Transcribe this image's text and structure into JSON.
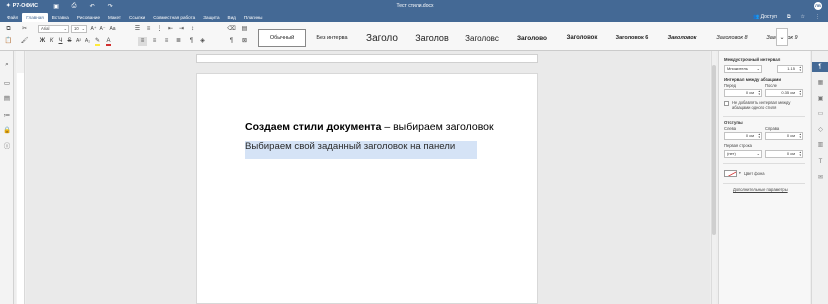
{
  "app": {
    "name": "Р7-ОФИС",
    "document_title": "Тест стили.docx",
    "user_initials": "ЛВ"
  },
  "menu": {
    "items": [
      "Файл",
      "Главная",
      "Вставка",
      "Рисование",
      "Макет",
      "Ссылки",
      "Совместная работа",
      "Защита",
      "Вид",
      "Плагины"
    ],
    "access_label": "Доступ"
  },
  "toolbar": {
    "font_name": "Arial",
    "font_size": "10",
    "styles": [
      "Обычный",
      "Без интерва",
      "Заголо",
      "Заголов",
      "Заголовс",
      "Заголово",
      "Заголовок",
      "Заголовок 6",
      "Заголовок",
      "Заголовок 8",
      "Заголовок 9"
    ]
  },
  "document": {
    "heading1_bold": "Создаем стили документа",
    "heading1_rest": " – выбираем заголовок",
    "heading2": "Выбираем свой заданный заголовок на панели"
  },
  "panel": {
    "line_spacing_title": "Междустрочный интервал",
    "line_spacing_mode": "Множитель",
    "line_spacing_value": "1.15",
    "para_spacing_title": "Интервал между абзацами",
    "before_label": "Перед",
    "after_label": "После",
    "before_value": "0 см",
    "after_value": "0.35 см",
    "same_style_check": "Не добавлять интервал между абзацами одного стиля",
    "indents_title": "Отступы",
    "left_label": "Слева",
    "right_label": "Справа",
    "left_value": "0 см",
    "right_value": "0 см",
    "first_line_label": "Первая строка",
    "first_line_mode": "(нет)",
    "first_line_value": "0 см",
    "bg_color_label": "Цвет фона",
    "advanced_link": "Дополнительные параметры"
  }
}
